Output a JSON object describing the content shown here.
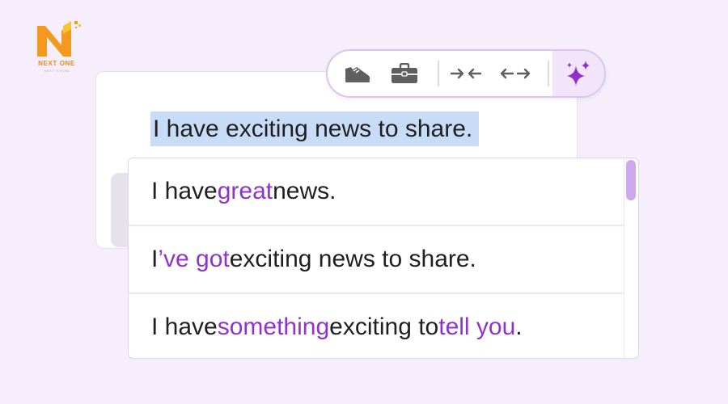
{
  "brand": {
    "name": "NEXT ONE",
    "tagline": "NEXT IS NOW",
    "colors": {
      "logo_orange": "#f39a1e",
      "logo_yellow": "#f7c531"
    }
  },
  "toolbar": {
    "buttons": [
      {
        "name": "casual-tone",
        "icon": "sneaker-icon"
      },
      {
        "name": "formal-tone",
        "icon": "briefcase-icon"
      },
      {
        "name": "shorten",
        "icon": "arrows-inward-icon"
      },
      {
        "name": "elaborate",
        "icon": "arrows-outward-icon"
      },
      {
        "name": "ai-rewrite",
        "icon": "sparkle-icon"
      }
    ]
  },
  "editor": {
    "selected_text": "I have exciting news to share."
  },
  "suggestions": [
    {
      "segments": [
        {
          "text": "I have ",
          "hl": false
        },
        {
          "text": "great",
          "hl": true
        },
        {
          "text": " news.",
          "hl": false
        }
      ]
    },
    {
      "segments": [
        {
          "text": "I",
          "hl": false
        },
        {
          "text": "’ve got",
          "hl": true
        },
        {
          "text": " exciting news to share.",
          "hl": false
        }
      ]
    },
    {
      "segments": [
        {
          "text": "I have ",
          "hl": false
        },
        {
          "text": "something",
          "hl": true
        },
        {
          "text": " exciting to ",
          "hl": false
        },
        {
          "text": "tell you",
          "hl": true
        },
        {
          "text": ".",
          "hl": false
        }
      ]
    }
  ],
  "colors": {
    "background": "#f6effb",
    "highlight_text": "#9233c7",
    "selection_bg": "#c9dcf7",
    "toolbar_border": "#d9c6ee",
    "ai_button_bg": "#f2e4fb",
    "scroll_thumb": "#cda8ec"
  }
}
